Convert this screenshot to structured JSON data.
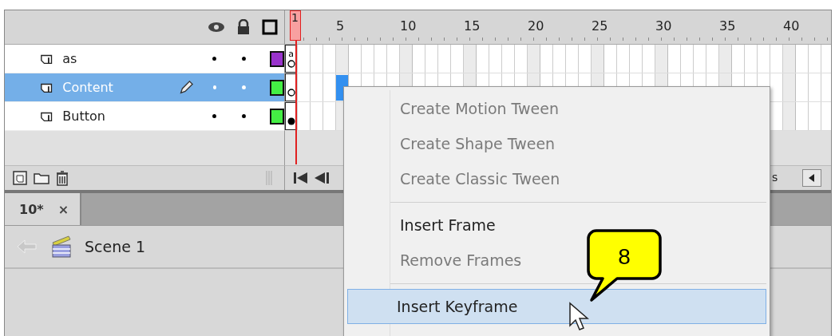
{
  "timeline": {
    "playhead_label": "1",
    "frame_numbers": [
      "5",
      "10",
      "15",
      "20",
      "25",
      "30",
      "35",
      "40"
    ],
    "layers": [
      {
        "name": "as",
        "selected": false,
        "editing": false,
        "visible": true,
        "locked": false,
        "color": "#9933cc",
        "keyframe_filled": false,
        "script_mark": "a",
        "frame_selected": false
      },
      {
        "name": "Content",
        "selected": true,
        "editing": true,
        "visible": true,
        "locked": false,
        "color": "#44ee44",
        "keyframe_filled": false,
        "frame_selected": true
      },
      {
        "name": "Button",
        "selected": false,
        "editing": false,
        "visible": true,
        "locked": false,
        "color": "#44ee44",
        "keyframe_filled": true,
        "frame_selected": false
      }
    ],
    "footer_text": "s"
  },
  "document_tabs": [
    {
      "label": "10*",
      "close": "×",
      "selected": true
    }
  ],
  "breadcrumb": {
    "scene": "Scene 1"
  },
  "context_menu": [
    {
      "kind": "item",
      "label": "Create Motion Tween",
      "disabled": true,
      "selected": false
    },
    {
      "kind": "item",
      "label": "Create Shape Tween",
      "disabled": true,
      "selected": false
    },
    {
      "kind": "item",
      "label": "Create Classic Tween",
      "disabled": true,
      "selected": false
    },
    {
      "kind": "separator"
    },
    {
      "kind": "item",
      "label": "Insert Frame",
      "disabled": false,
      "selected": false
    },
    {
      "kind": "item",
      "label": "Remove Frames",
      "disabled": true,
      "selected": false
    },
    {
      "kind": "separator"
    },
    {
      "kind": "item",
      "label": "Insert Keyframe",
      "disabled": false,
      "selected": true
    }
  ],
  "callout": {
    "label": "8"
  }
}
